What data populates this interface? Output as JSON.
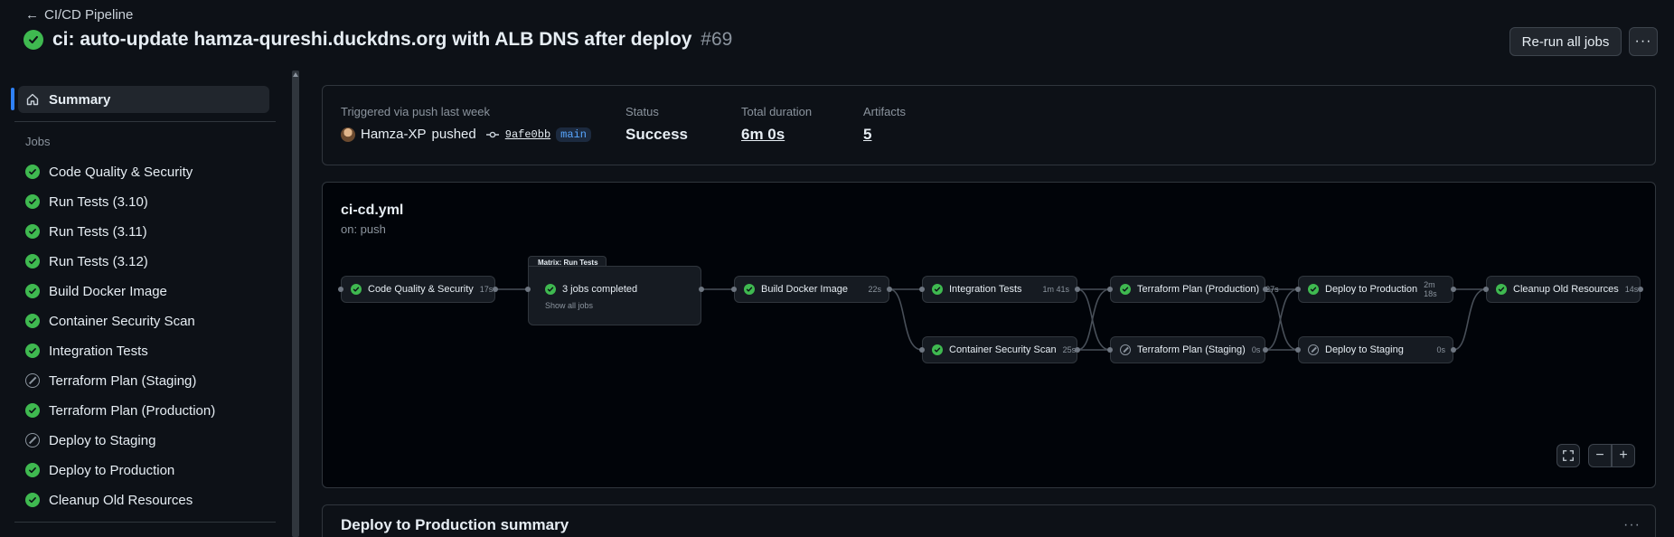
{
  "header": {
    "back_label": "CI/CD Pipeline",
    "title": "ci: auto-update hamza-qureshi.duckdns.org with ALB DNS after deploy",
    "run_number": "#69",
    "rerun_label": "Re-run all jobs",
    "more_label": "···"
  },
  "sidebar": {
    "summary_label": "Summary",
    "jobs_heading": "Jobs",
    "jobs": [
      {
        "label": "Code Quality & Security",
        "status": "success"
      },
      {
        "label": "Run Tests (3.10)",
        "status": "success"
      },
      {
        "label": "Run Tests (3.11)",
        "status": "success"
      },
      {
        "label": "Run Tests (3.12)",
        "status": "success"
      },
      {
        "label": "Build Docker Image",
        "status": "success"
      },
      {
        "label": "Container Security Scan",
        "status": "success"
      },
      {
        "label": "Integration Tests",
        "status": "success"
      },
      {
        "label": "Terraform Plan (Staging)",
        "status": "skipped"
      },
      {
        "label": "Terraform Plan (Production)",
        "status": "success"
      },
      {
        "label": "Deploy to Staging",
        "status": "skipped"
      },
      {
        "label": "Deploy to Production",
        "status": "success"
      },
      {
        "label": "Cleanup Old Resources",
        "status": "success"
      }
    ]
  },
  "summary": {
    "trigger_text": "Triggered via push last week",
    "actor": "Hamza-XP",
    "action": "pushed",
    "commit": "9afe0bb",
    "branch": "main",
    "status_label": "Status",
    "status_value": "Success",
    "duration_label": "Total duration",
    "duration_value": "6m 0s",
    "artifacts_label": "Artifacts",
    "artifacts_value": "5"
  },
  "graph": {
    "workflow_file": "ci-cd.yml",
    "workflow_trigger": "on: push",
    "matrix_label": "Matrix: Run Tests",
    "matrix_summary": "3 jobs completed",
    "matrix_show_all": "Show all jobs",
    "nodes": [
      {
        "name": "Code Quality & Security",
        "duration": "17s",
        "status": "success"
      },
      {
        "name": "Build Docker Image",
        "duration": "22s",
        "status": "success"
      },
      {
        "name": "Integration Tests",
        "duration": "1m 41s",
        "status": "success"
      },
      {
        "name": "Container Security Scan",
        "duration": "25s",
        "status": "success"
      },
      {
        "name": "Terraform Plan (Production)",
        "duration": "27s",
        "status": "success"
      },
      {
        "name": "Terraform Plan (Staging)",
        "duration": "0s",
        "status": "skipped"
      },
      {
        "name": "Deploy to Production",
        "duration": "2m 18s",
        "status": "success"
      },
      {
        "name": "Deploy to Staging",
        "duration": "0s",
        "status": "skipped"
      },
      {
        "name": "Cleanup Old Resources",
        "duration": "14s",
        "status": "success"
      }
    ]
  },
  "deploy_summary": {
    "title": "Deploy to Production summary",
    "more_label": "···"
  },
  "colors": {
    "success": "#3fb950",
    "accent": "#2f81f7",
    "background": "#0d1117"
  }
}
